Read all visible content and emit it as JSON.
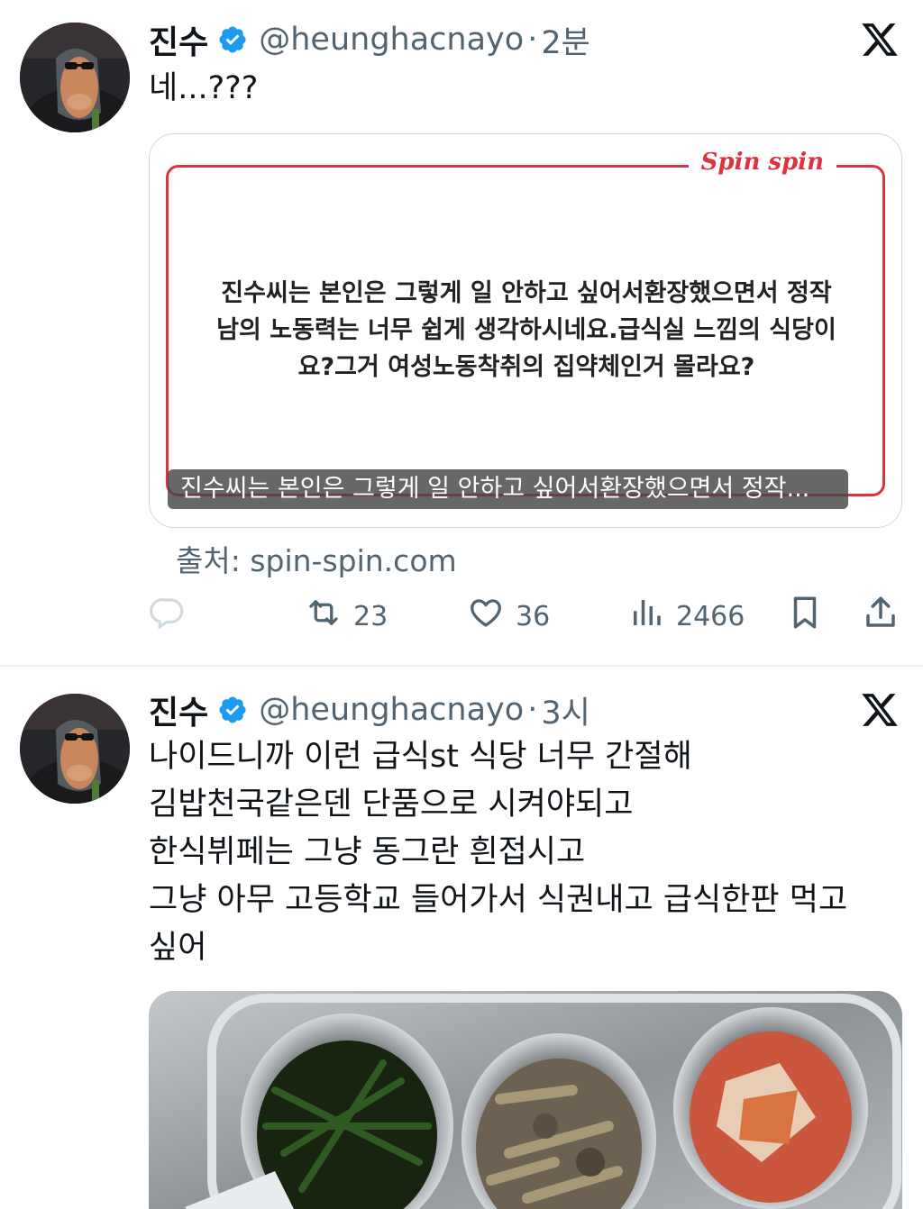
{
  "tweets": [
    {
      "author": {
        "name": "진수",
        "handle": "@heunghacnayo",
        "verified": true
      },
      "time": "2분",
      "text_lines": [
        "네...???"
      ],
      "card": {
        "brand": "Spin spin",
        "quote_lines": [
          "진수씨는 본인은 그렇게 일 안하고 싶어서환장했으면서 정작",
          "남의 노동력는 너무 쉽게 생각하시네요.급식실 느낌의 식당이",
          "요?그거 여성노동착취의 집약체인거 몰라요?"
        ],
        "caption": "진수씨는 본인은 그렇게 일 안하고 싶어서환장했으면서 정작...",
        "source": "출처: spin-spin.com"
      },
      "actions": {
        "retweets": "23",
        "likes": "36",
        "views": "2466"
      }
    },
    {
      "author": {
        "name": "진수",
        "handle": "@heunghacnayo",
        "verified": true
      },
      "time": "3시",
      "text_lines": [
        "나이드니까 이런 급식st 식당 너무 간절해",
        "김밥천국같은덴 단품으로 시켜야되고",
        "한식뷔페는 그냥 동그란 흰접시고",
        "그냥 아무 고등학교 들어가서 식권내고 급식한판 먹고",
        "싶어"
      ]
    }
  ],
  "ui": {
    "separator": "·"
  },
  "colors": {
    "accent_red": "#e0313f",
    "verified_blue": "#1d9bf0",
    "muted": "#536471",
    "text": "#0f1419"
  },
  "icons": [
    "x-logo-icon",
    "verified-badge-icon",
    "reply-icon",
    "retweet-icon",
    "like-icon",
    "views-icon",
    "bookmark-icon",
    "share-icon"
  ]
}
